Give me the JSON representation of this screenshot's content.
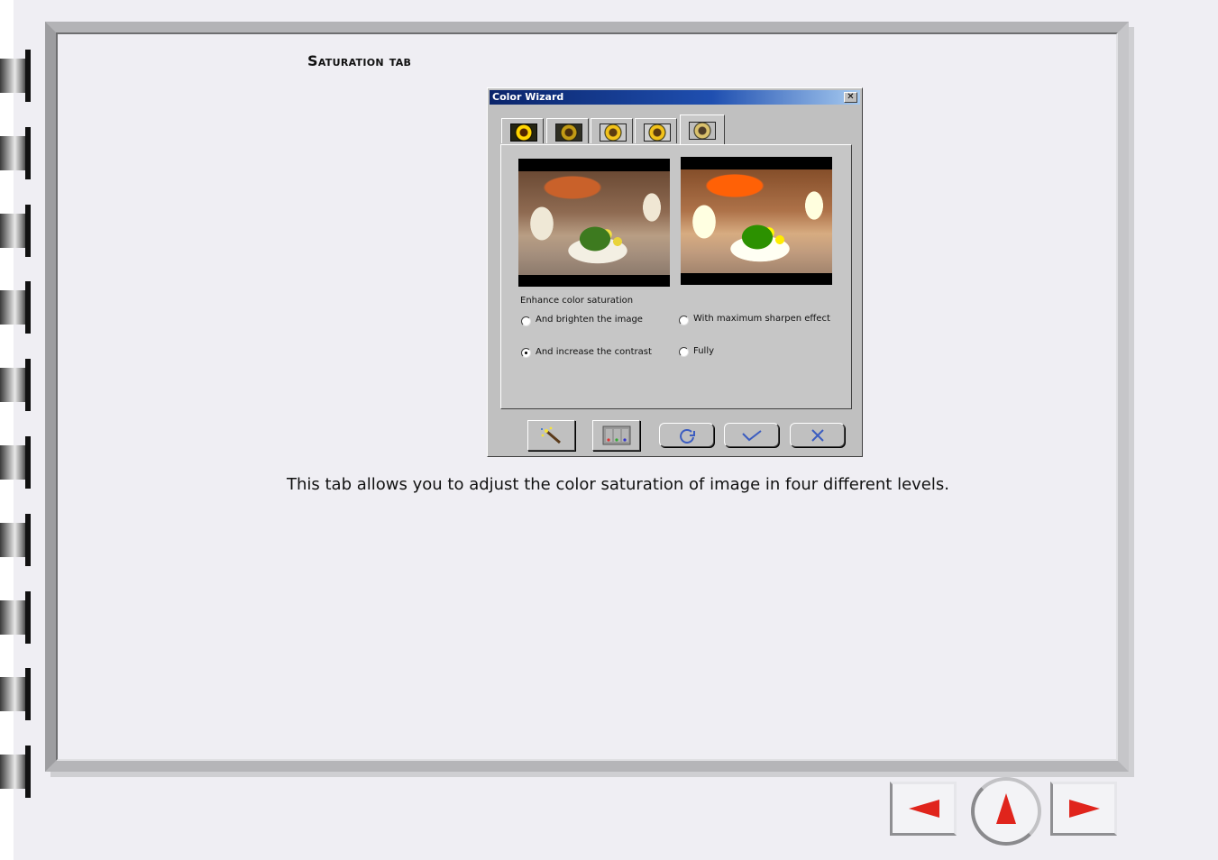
{
  "page": {
    "section_title": "Saturation tab",
    "description": "This tab allows you to adjust the color saturation of image in four different levels."
  },
  "dialog": {
    "title": "Color Wizard",
    "close_glyph": "✕",
    "tabs": [
      {
        "icon": "sunflower-original-icon",
        "active": false
      },
      {
        "icon": "sunflower-dark-icon",
        "active": false
      },
      {
        "icon": "sunflower-color-icon",
        "active": false
      },
      {
        "icon": "sunflower-contrast-icon",
        "active": false
      },
      {
        "icon": "sunflower-saturation-icon",
        "active": true
      }
    ],
    "group_label": "Enhance color saturation",
    "options": {
      "brighten": {
        "label": "And brighten the image",
        "checked": false
      },
      "contrast": {
        "label": "And increase the contrast",
        "checked": true
      },
      "sharpen": {
        "label": "With maximum sharpen effect",
        "checked": false
      },
      "fully": {
        "label": "Fully",
        "checked": false
      }
    },
    "buttons": {
      "wizard": "magic-wand-icon",
      "levels": "levels-icon",
      "reset": "reset-icon",
      "ok": "checkmark-icon",
      "cancel": "close-icon"
    }
  },
  "colors": {
    "page_background": "#efeef3",
    "titlebar": "#0a246a",
    "nav_arrow": "#e0241c"
  }
}
